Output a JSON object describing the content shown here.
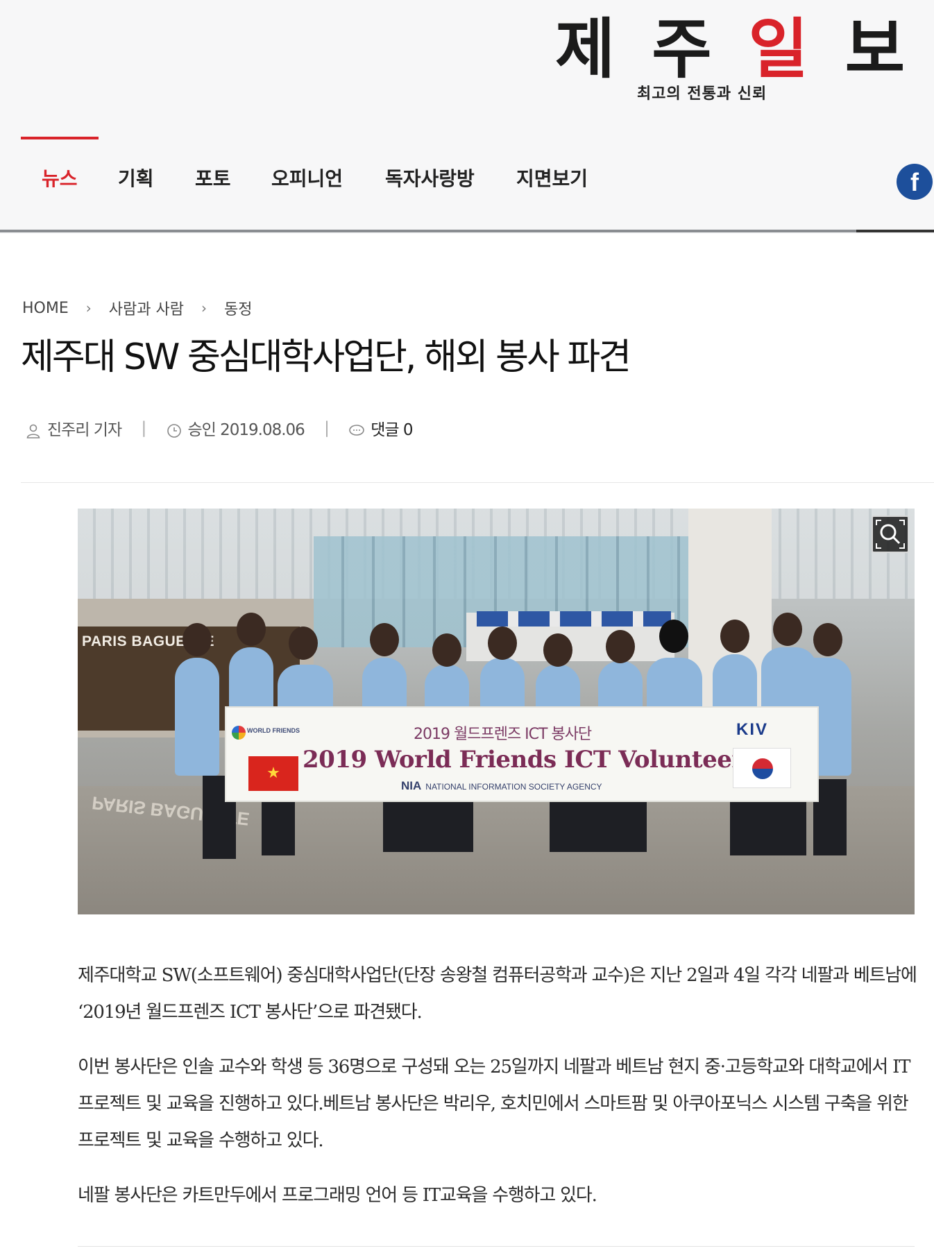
{
  "site": {
    "logo_text_left": "제 주 ",
    "logo_text_red": "일",
    "logo_text_right": " 보",
    "slogan": "최고의 전통과 신뢰",
    "facebook_icon_glyph": "f",
    "brand_red": "#d9232a",
    "facebook_blue": "#1d4f9b"
  },
  "nav": {
    "items": [
      {
        "label": "뉴스",
        "active": true
      },
      {
        "label": "기획",
        "active": false
      },
      {
        "label": "포토",
        "active": false
      },
      {
        "label": "오피니언",
        "active": false
      },
      {
        "label": "독자사랑방",
        "active": false
      },
      {
        "label": "지면보기",
        "active": false
      }
    ]
  },
  "breadcrumb": {
    "home": "HOME",
    "level1": "사람과 사람",
    "level2": "동정",
    "separator": "›"
  },
  "article": {
    "title": "제주대 SW 중심대학사업단, 해외 봉사 파견",
    "author": "진주리 기자",
    "approved": "승인 2019.08.06",
    "comments": "댓글 0",
    "meta_divider": "|",
    "photo": {
      "shop_sign": "PARIS BAGUETTE",
      "shop_reflection": "PARIS BAGUETTE",
      "banner_korean": "2019 월드프렌즈 ICT 봉사단",
      "banner_english": "2019 World Friends ICT Volunteers",
      "banner_agency_short": "NIA",
      "banner_agency_full": "NATIONAL INFORMATION SOCIETY AGENCY",
      "banner_wf": "WORLD FRIENDS",
      "banner_kiv": "KIV",
      "vn_flag_star": "★"
    },
    "paragraphs": [
      "제주대학교 SW(소프트웨어) 중심대학사업단(단장 송왕철 컴퓨터공학과 교수)은 지난 2일과 4일 각각 네팔과 베트남에 ‘2019년 월드프렌즈 ICT 봉사단’으로 파견됐다.",
      "이번 봉사단은 인솔 교수와 학생 등 36명으로 구성돼 오는 25일까지 네팔과 베트남 현지 중·고등학교와 대학교에서 IT 프로젝트 및 교육을 진행하고 있다.베트남 봉사단은 박리우, 호치민에서 스마트팜 및 아쿠아포닉스 시스템 구축을 위한 프로젝트 및 교육을 수행하고 있다.",
      "네팔 봉사단은 카트만두에서 프로그래밍 언어 등 IT교육을 수행하고 있다."
    ]
  }
}
